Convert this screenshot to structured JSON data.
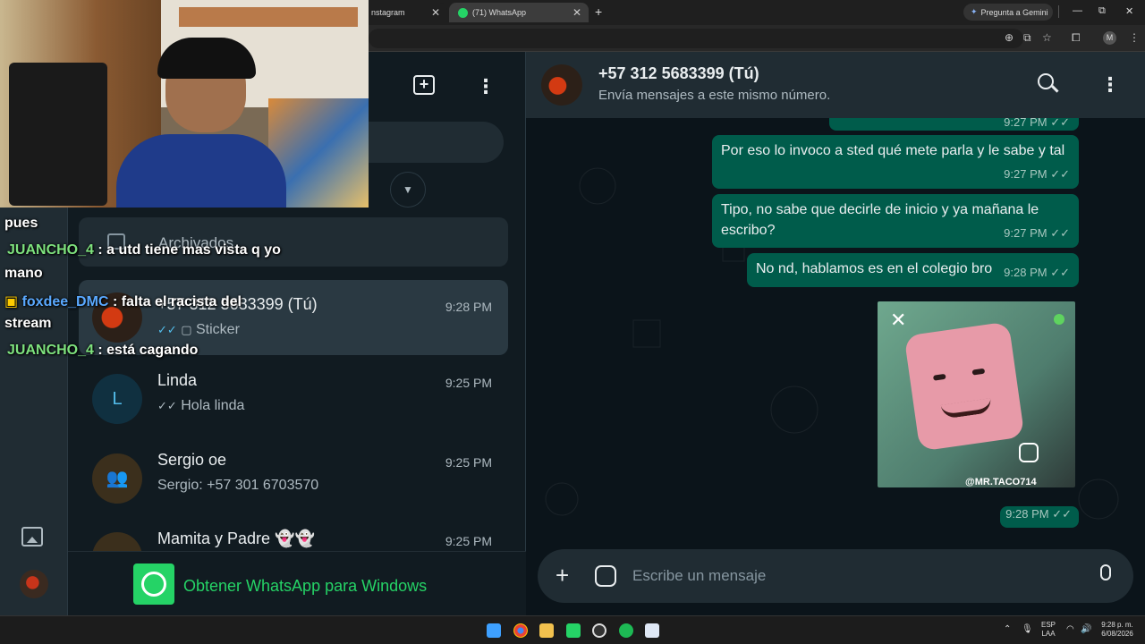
{
  "browser": {
    "tabs": [
      {
        "label": "nstagram",
        "active": false
      },
      {
        "label": "(71) WhatsApp",
        "active": true
      }
    ],
    "new_tab": "+",
    "gemini_label": "Pregunta a Gemini",
    "profile_initial": "M",
    "window_controls": {
      "minimize": "—",
      "maximize": "⧉",
      "close": "✕"
    }
  },
  "sidebar": {
    "archived_label": "Archivados",
    "chats": [
      {
        "name": "+57 312 5683399 (Tú)",
        "time": "9:28 PM",
        "preview": "Sticker",
        "ticks": "✓✓",
        "avatar": "photo"
      },
      {
        "name": "Linda",
        "time": "9:25 PM",
        "preview": "Hola linda",
        "ticks": "✓✓",
        "avatar_letter": "L"
      },
      {
        "name": "Sergio oe",
        "time": "9:25 PM",
        "preview": "Sergio: +57 301 6703570",
        "avatar": "group"
      },
      {
        "name": "Mamita y Padre 👻👻",
        "time": "9:25 PM",
        "preview": "",
        "avatar": "group"
      }
    ],
    "get_app_label": "Obtener WhatsApp para Windows"
  },
  "chat": {
    "contact_name": "+57 312 5683399 (Tú)",
    "contact_subtitle": "Envía mensajes a este mismo número.",
    "messages": [
      {
        "text": "",
        "time": "9:27 PM"
      },
      {
        "text": "Por eso lo invoco a sted qué mete parla y le sabe y tal",
        "time": "9:27 PM"
      },
      {
        "text": "Tipo, no sabe que decirle de inicio y ya mañana le escribo?",
        "time": "9:27 PM"
      },
      {
        "text": "No nd, hablamos es en el colegio bro",
        "time": "9:28 PM"
      },
      {
        "sticker_watermark": "@MR.TACO714",
        "time": "9:28 PM"
      }
    ],
    "composer_placeholder": "Escribe un mensaje"
  },
  "stream_chat": [
    {
      "user": "",
      "text": "pues"
    },
    {
      "user": "JUANCHO_4",
      "text": ": a utd tiene mas vista q yo"
    },
    {
      "user": "",
      "text": "mano"
    },
    {
      "user": "foxdee_DMC",
      "text": ": falta el racista del"
    },
    {
      "user": "",
      "text": "stream"
    },
    {
      "user": "JUANCHO_4",
      "text": ": está cagando"
    }
  ],
  "taskbar": {
    "lang_top": "ESP",
    "lang_bottom": "LAA",
    "time": "9:28 p. m.",
    "date": "6/08/2026"
  },
  "colors": {
    "accent": "#00a884",
    "bubble": "#005c4b",
    "panel": "#111b21",
    "header": "#202c33"
  },
  "icons": [
    "new-chat-icon",
    "menu-icon",
    "search-icon",
    "archive-icon",
    "attach-icon",
    "sticker-icon",
    "mic-icon",
    "whatsapp-icon"
  ]
}
